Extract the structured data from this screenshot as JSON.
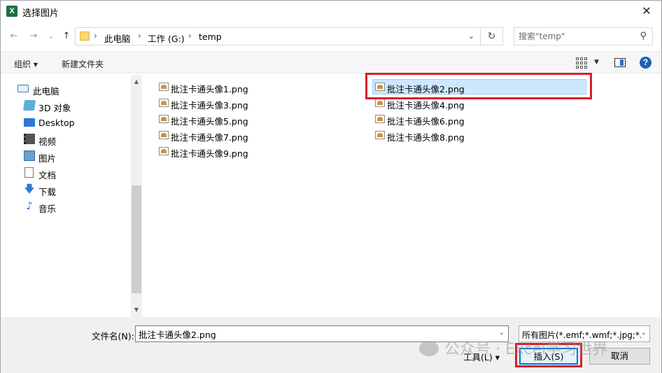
{
  "window": {
    "title": "选择图片",
    "app_icon": "X"
  },
  "nav": {
    "back_icon": "←",
    "forward_icon": "→",
    "recent_icon": "⌄",
    "up_icon": "↑",
    "breadcrumb": [
      "此电脑",
      "工作 (G:)",
      "temp"
    ],
    "separator": "›",
    "search_placeholder": "搜索\"temp\""
  },
  "toolbar": {
    "organize": "组织 ▾",
    "new_folder": "新建文件夹",
    "help": "?"
  },
  "sidebar": {
    "items": [
      {
        "label": "此电脑"
      },
      {
        "label": "3D 对象"
      },
      {
        "label": "Desktop"
      },
      {
        "label": "视频"
      },
      {
        "label": "图片"
      },
      {
        "label": "文档"
      },
      {
        "label": "下载"
      },
      {
        "label": "音乐"
      }
    ]
  },
  "files": [
    {
      "name": "批注卡通头像1.png",
      "selected": false
    },
    {
      "name": "批注卡通头像2.png",
      "selected": true
    },
    {
      "name": "批注卡通头像3.png",
      "selected": false
    },
    {
      "name": "批注卡通头像4.png",
      "selected": false
    },
    {
      "name": "批注卡通头像5.png",
      "selected": false
    },
    {
      "name": "批注卡通头像6.png",
      "selected": false
    },
    {
      "name": "批注卡通头像7.png",
      "selected": false
    },
    {
      "name": "批注卡通头像8.png",
      "selected": false
    },
    {
      "name": "批注卡通头像9.png",
      "selected": false
    }
  ],
  "bottom": {
    "filename_label": "文件名(N):",
    "filename_value": "批注卡通头像2.png",
    "filetype": "所有图片(*.emf;*.wmf;*.jpg;*.j",
    "tools": "工具(L)",
    "insert": "插入(S)",
    "cancel": "取消"
  },
  "watermark": "公众号 · Excel学习世界",
  "colors": {
    "highlight": "#d4202c",
    "selection": "#cce8ff",
    "accent": "#0078d7"
  }
}
